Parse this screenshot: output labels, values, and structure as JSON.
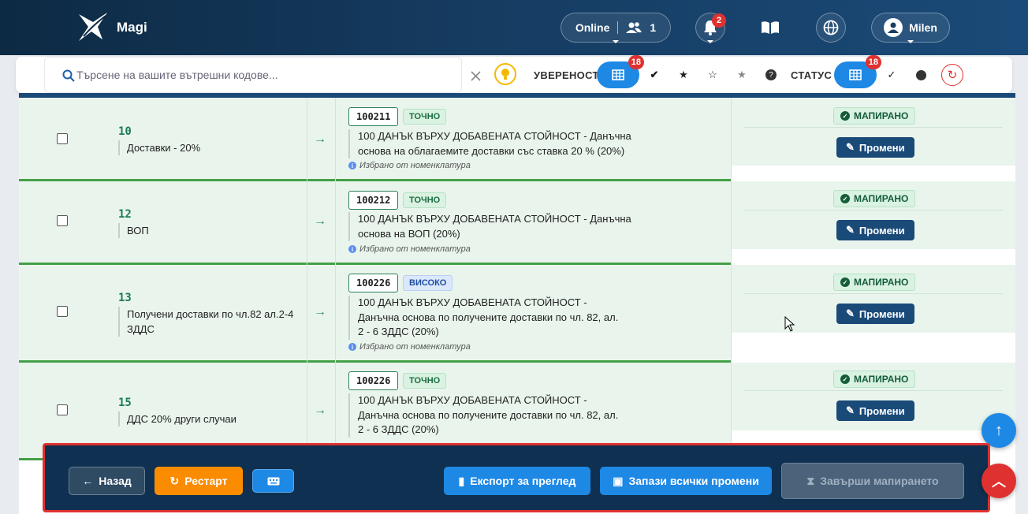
{
  "app": {
    "name": "Magi"
  },
  "header": {
    "online_label": "Online",
    "online_count": "1",
    "notifications_count": "2",
    "user_name": "Milen"
  },
  "filters": {
    "search_placeholder": "Търсене на вашите вътрешни кодове...",
    "confidence_label": "УВЕРЕНОСТ",
    "confidence_badge": "18",
    "status_label": "СТАТУС",
    "status_badge": "18"
  },
  "rows": [
    {
      "code": "10",
      "name": "Доставки - 20%",
      "account": "100211",
      "confidence": "ТОЧНО",
      "desc": "100 ДАНЪК ВЪРХУ ДОБАВЕНАТА СТОЙНОСТ - Данъчна основа на облагаемите доставки със ставка 20 % (20%)",
      "picked": "Избрано от номенклатура",
      "status": "МАПИРАНО",
      "edit": "Промени"
    },
    {
      "code": "12",
      "name": "ВОП",
      "account": "100212",
      "confidence": "ТОЧНО",
      "desc": "100 ДАНЪК ВЪРХУ ДОБАВЕНАТА СТОЙНОСТ - Данъчна основа на ВОП (20%)",
      "picked": "Избрано от номенклатура",
      "status": "МАПИРАНО",
      "edit": "Промени"
    },
    {
      "code": "13",
      "name": "Получени доставки по чл.82 ал.2-4 ЗДДС",
      "account": "100226",
      "confidence": "ВИСОКО",
      "desc": "100 ДАНЪК ВЪРХУ ДОБАВЕНАТА СТОЙНОСТ - Данъчна основа по получените доставки по чл. 82, ал. 2 - 6 ЗДДС (20%)",
      "picked": "Избрано от номенклатура",
      "status": "МАПИРАНО",
      "edit": "Промени"
    },
    {
      "code": "15",
      "name": "ДДС 20% други случаи",
      "account": "100226",
      "confidence": "ТОЧНО",
      "desc": "100 ДАНЪК ВЪРХУ ДОБАВЕНАТА СТОЙНОСТ - Данъчна основа по получените доставки по чл. 82, ал. 2 - 6 ЗДДС (20%)",
      "picked": "",
      "status": "МАПИРАНО",
      "edit": "Промени"
    }
  ],
  "footer": {
    "back": "Назад",
    "restart": "Рестарт",
    "export": "Експорт за преглед",
    "save_all": "Запази всички промени",
    "finish": "Завърши мапирането"
  },
  "colors": {
    "accent": "#1e88e5",
    "mapped_row": "#e9f5ec",
    "row_border": "#43a047",
    "restart": "#fb8c00",
    "highlight": "#e03131"
  }
}
